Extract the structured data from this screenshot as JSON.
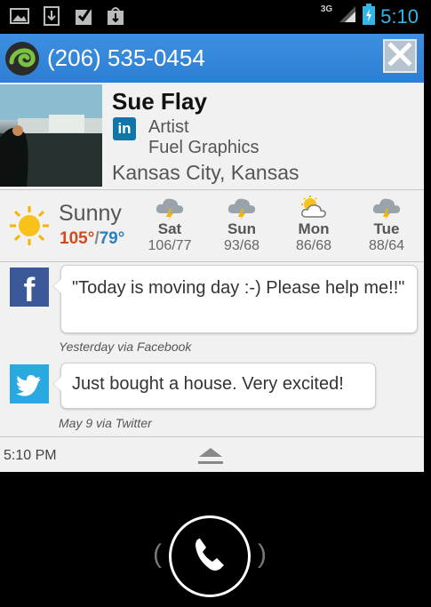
{
  "status_bar": {
    "network_type": "3G",
    "time": "5:10",
    "notification_icons": [
      "image-icon",
      "download-icon",
      "checkbox-icon",
      "shopping-bag-icon"
    ],
    "accent_color": "#33b5e5"
  },
  "caller": {
    "phone_number": "(206) 535-0454",
    "logo_icon": "swirl-logo-icon",
    "close_icon": "close-icon",
    "bar_color": "#3584db"
  },
  "contact": {
    "name": "Sue Flay",
    "network_badge": "in",
    "job_title": "Artist",
    "company": "Fuel Graphics",
    "location": "Kansas City, Kansas"
  },
  "weather": {
    "condition": "Sunny",
    "high": "105°",
    "separator": "/",
    "low": "79°",
    "forecast": [
      {
        "day": "Sat",
        "range": "106/77",
        "icon": "thunderstorm-icon"
      },
      {
        "day": "Sun",
        "range": "93/68",
        "icon": "thunderstorm-icon"
      },
      {
        "day": "Mon",
        "range": "86/68",
        "icon": "partly-cloudy-icon"
      },
      {
        "day": "Tue",
        "range": "88/64",
        "icon": "thunderstorm-icon"
      }
    ]
  },
  "posts": [
    {
      "source_icon": "facebook-icon",
      "text": "\"Today is moving day :-)  Please help me!!\"",
      "meta": "Yesterday via Facebook"
    },
    {
      "source_icon": "twitter-icon",
      "text": "Just bought a house.  Very excited!",
      "meta": "May 9 via Twitter"
    }
  ],
  "footer": {
    "time": "5:10 PM",
    "expand_icon": "expand-up-icon"
  },
  "answer": {
    "icon": "phone-handset-icon"
  }
}
